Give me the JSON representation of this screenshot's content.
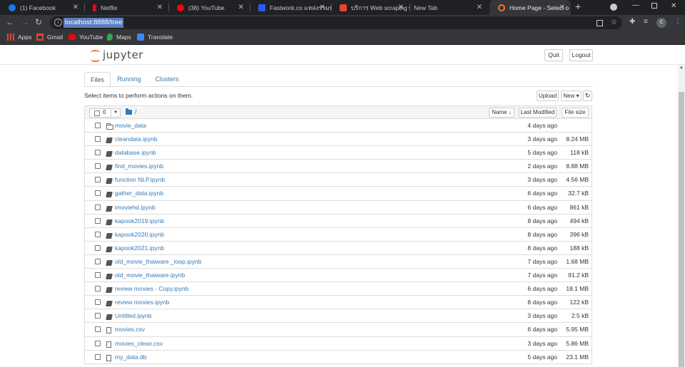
{
  "browser": {
    "tabs": [
      {
        "label": "(1) Facebook",
        "color": "#1877f2"
      },
      {
        "label": "Netflix",
        "color": "#e50914"
      },
      {
        "label": "(38) YouTube",
        "color": "#ff0000"
      },
      {
        "label": "Fastwork.co แหล่งรวมฟ",
        "color": "#2b59ff"
      },
      {
        "label": "บริการ Web scraping w",
        "color": "#ea4335"
      },
      {
        "label": "New Tab",
        "color": ""
      },
      {
        "label": "Home Page - Select o",
        "color": "#f37626"
      }
    ],
    "new_tab_glyph": "+",
    "close_glyph": "✕",
    "url": "localhost:8888/tree",
    "avatar_letter": "C",
    "bookmarks": [
      {
        "label": "Apps",
        "icon": "apps-grid-icon",
        "color": "#ea4335"
      },
      {
        "label": "Gmail",
        "icon": "gmail-icon",
        "color": "#ea4335"
      },
      {
        "label": "YouTube",
        "icon": "youtube-icon",
        "color": "#ff0000"
      },
      {
        "label": "Maps",
        "icon": "maps-pin-icon",
        "color": "#34a853"
      },
      {
        "label": "Translate",
        "icon": "translate-icon",
        "color": "#4285f4"
      }
    ]
  },
  "jupyter": {
    "logo_text": "jupyter",
    "quit_label": "Quit",
    "logout_label": "Logout",
    "tabs": [
      "Files",
      "Running",
      "Clusters"
    ],
    "instruction": "Select items to perform actions on them.",
    "upload_label": "Upload",
    "new_label": "New ▾",
    "refresh_glyph": "↻",
    "selected_count": "0",
    "breadcrumb": "/",
    "sort_name": "Name ↓",
    "sort_modified": "Last Modified",
    "sort_size": "File size",
    "files": [
      {
        "name": "movie_data",
        "type": "folder",
        "modified": "4 days ago",
        "size": ""
      },
      {
        "name": "cleandata.ipynb",
        "type": "notebook",
        "modified": "3 days ago",
        "size": "8.24 MB"
      },
      {
        "name": "database.ipynb",
        "type": "notebook",
        "modified": "5 days ago",
        "size": "118 kB"
      },
      {
        "name": "find_movies.ipynb",
        "type": "notebook",
        "modified": "2 days ago",
        "size": "8.88 MB"
      },
      {
        "name": "function NLP.ipynb",
        "type": "notebook",
        "modified": "3 days ago",
        "size": "4.56 MB"
      },
      {
        "name": "gather_data.ipynb",
        "type": "notebook",
        "modified": "6 days ago",
        "size": "32.7 kB"
      },
      {
        "name": "imoviehd.ipynb",
        "type": "notebook",
        "modified": "6 days ago",
        "size": "861 kB"
      },
      {
        "name": "kapook2019.ipynb",
        "type": "notebook",
        "modified": "8 days ago",
        "size": "494 kB"
      },
      {
        "name": "kapook2020.ipynb",
        "type": "notebook",
        "modified": "8 days ago",
        "size": "396 kB"
      },
      {
        "name": "kapook2021.ipynb",
        "type": "notebook",
        "modified": "8 days ago",
        "size": "188 kB"
      },
      {
        "name": "old_movie_thaiware _loop.ipynb",
        "type": "notebook",
        "modified": "7 days ago",
        "size": "1.68 MB"
      },
      {
        "name": "old_movie_thaiware.ipynb",
        "type": "notebook",
        "modified": "7 days ago",
        "size": "91.2 kB"
      },
      {
        "name": "review movies - Copy.ipynb",
        "type": "notebook",
        "modified": "6 days ago",
        "size": "18.1 MB"
      },
      {
        "name": "review movies.ipynb",
        "type": "notebook",
        "modified": "8 days ago",
        "size": "122 kB"
      },
      {
        "name": "Untitled.ipynb",
        "type": "notebook",
        "modified": "3 days ago",
        "size": "2.5 kB"
      },
      {
        "name": "movies.csv",
        "type": "file",
        "modified": "6 days ago",
        "size": "5.95 MB"
      },
      {
        "name": "movies_clean.csv",
        "type": "file",
        "modified": "3 days ago",
        "size": "5.86 MB"
      },
      {
        "name": "my_data.db",
        "type": "file",
        "modified": "5 days ago",
        "size": "23.1 MB"
      }
    ]
  }
}
